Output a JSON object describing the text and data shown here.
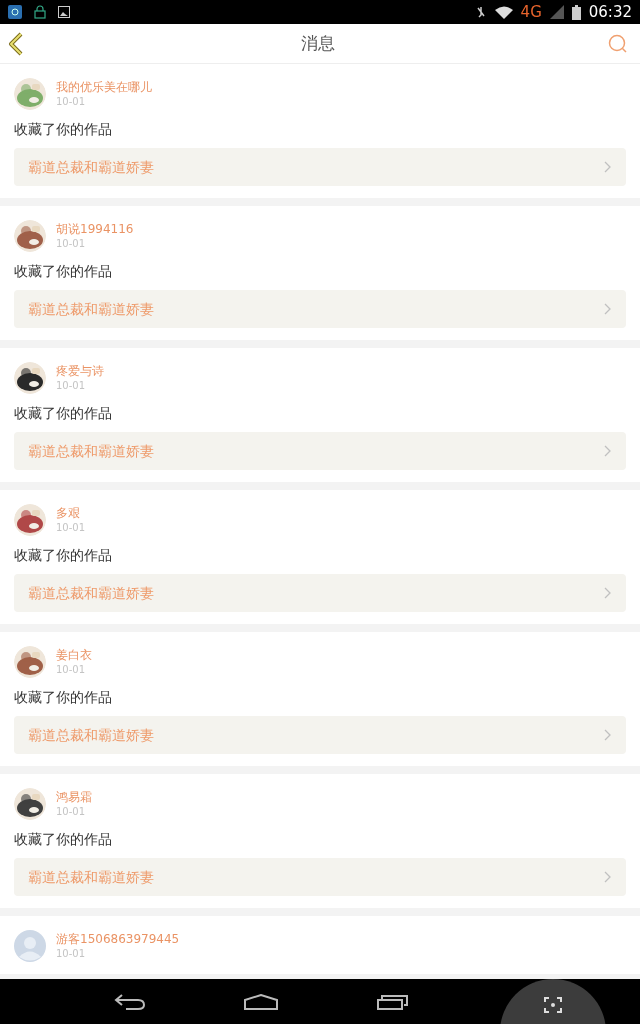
{
  "status_bar": {
    "network": "4G",
    "time": "06:32"
  },
  "header": {
    "title": "消息"
  },
  "messages": [
    {
      "user": "我的优乐美在哪儿",
      "date": "10-01",
      "action": "收藏了你的作品",
      "work": "霸道总裁和霸道娇妻"
    },
    {
      "user": "胡说1994116",
      "date": "10-01",
      "action": "收藏了你的作品",
      "work": "霸道总裁和霸道娇妻"
    },
    {
      "user": "疼爱与诗",
      "date": "10-01",
      "action": "收藏了你的作品",
      "work": "霸道总裁和霸道娇妻"
    },
    {
      "user": "多艰",
      "date": "10-01",
      "action": "收藏了你的作品",
      "work": "霸道总裁和霸道娇妻"
    },
    {
      "user": "姜白衣",
      "date": "10-01",
      "action": "收藏了你的作品",
      "work": "霸道总裁和霸道娇妻"
    },
    {
      "user": "鸿易霜",
      "date": "10-01",
      "action": "收藏了你的作品",
      "work": "霸道总裁和霸道娇妻"
    },
    {
      "user": "游客1506863979445",
      "date": "10-01",
      "avatar": {
        "kind": "default"
      }
    }
  ]
}
